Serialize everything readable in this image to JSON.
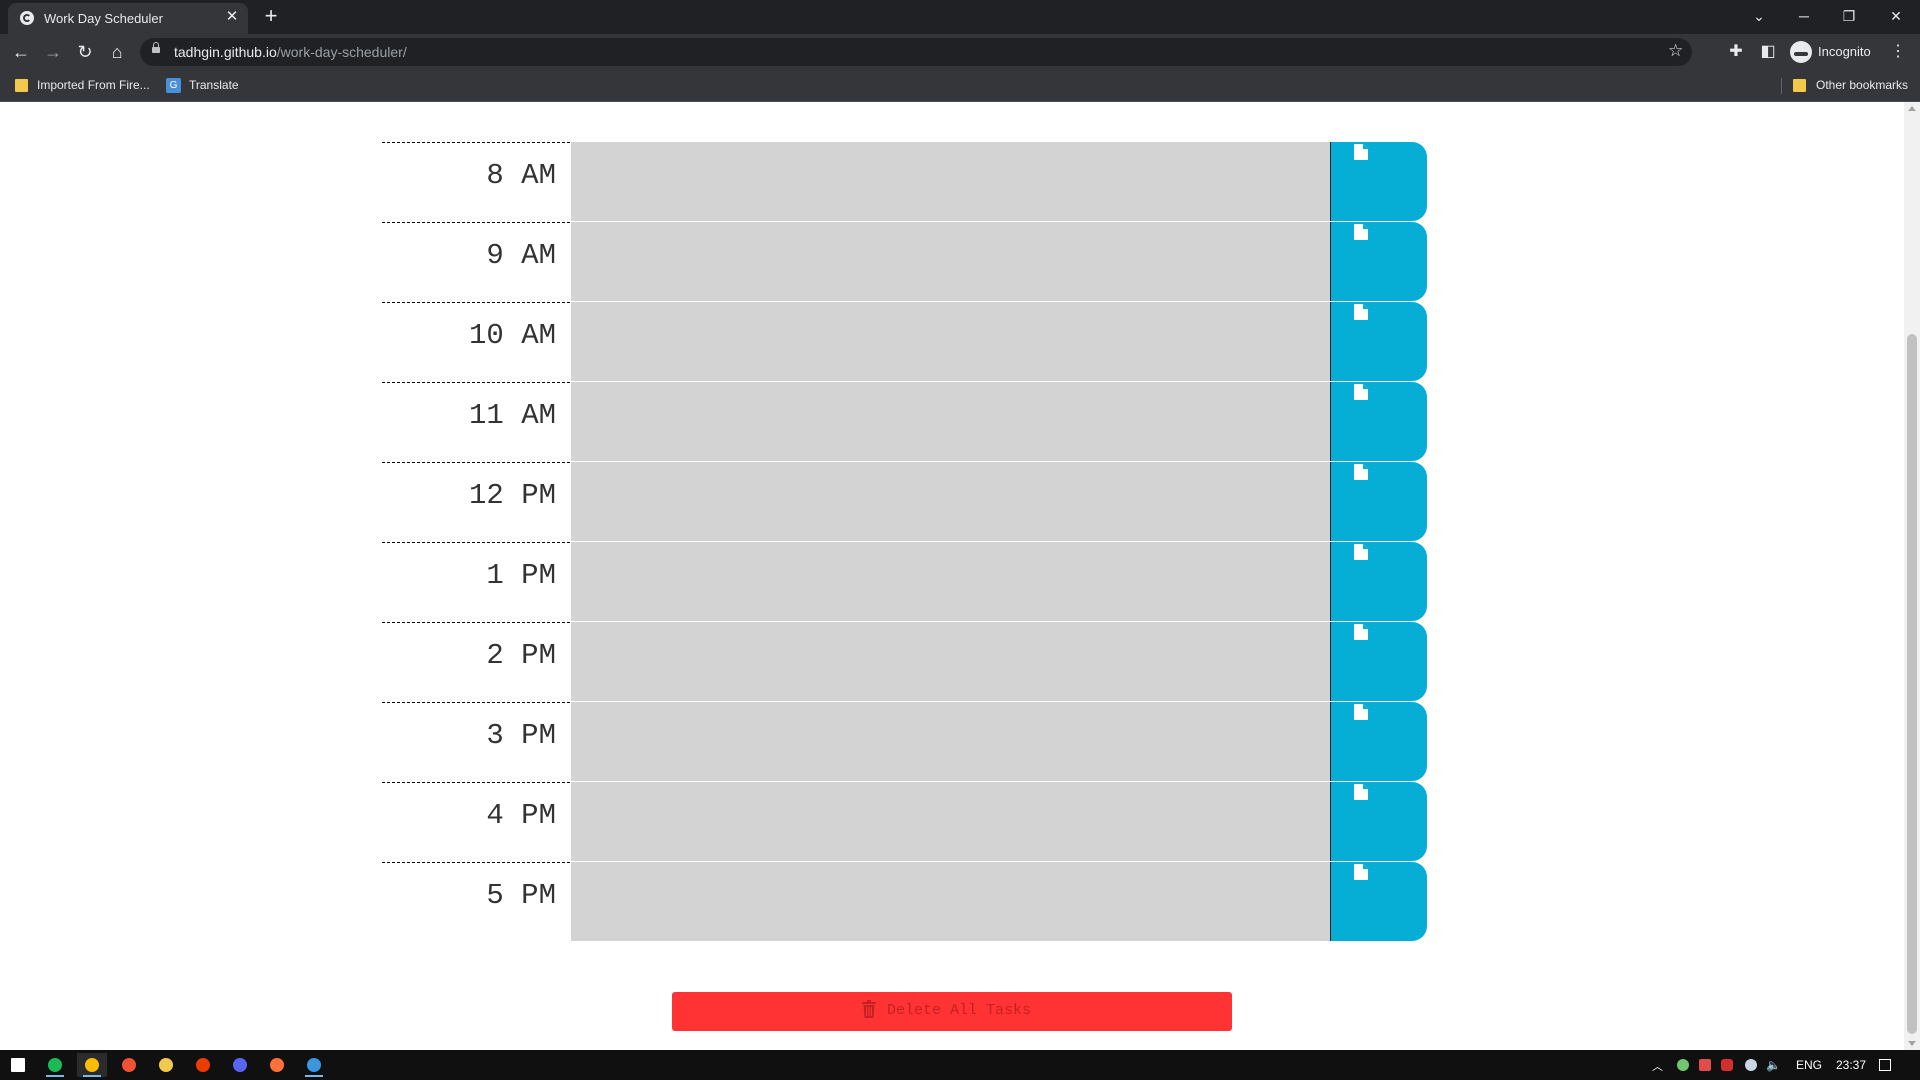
{
  "browser": {
    "tab_title": "Work Day Scheduler",
    "tab_close_glyph": "✕",
    "new_tab_glyph": "+",
    "url_host": "tadhgin.github.io",
    "url_path": "/work-day-scheduler/",
    "incognito_label": "Incognito",
    "bookmarks": [
      "Imported From Fire...",
      "Translate"
    ],
    "other_bookmarks": "Other bookmarks"
  },
  "schedule": {
    "hours": [
      "8 AM",
      "9 AM",
      "10 AM",
      "11 AM",
      "12 PM",
      "1 PM",
      "2 PM",
      "3 PM",
      "4 PM",
      "5 PM"
    ],
    "tasks": [
      "",
      "",
      "",
      "",
      "",
      "",
      "",
      "",
      "",
      ""
    ],
    "save_icon": "file-icon",
    "save_color": "#06aed5",
    "past_color": "#d3d3d3"
  },
  "delete_button": {
    "label": "Delete All Tasks",
    "icon": "trash-icon",
    "color": "#ff3333"
  },
  "taskbar": {
    "apps": [
      "windows-start-icon",
      "spotify-icon",
      "chrome-icon",
      "git-icon",
      "file-explorer-icon",
      "office-icon",
      "discord-icon",
      "firefox-icon",
      "vscode-icon"
    ],
    "language": "ENG",
    "time": "23:37"
  }
}
